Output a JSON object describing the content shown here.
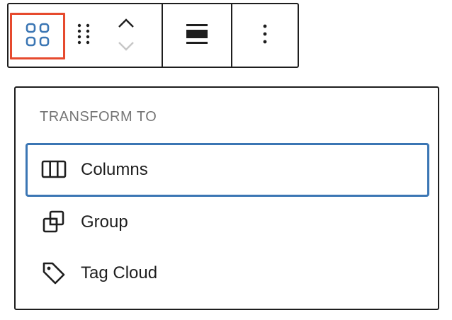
{
  "toolbar": {
    "parent_icon": "block-default-grid-icon",
    "drag_icon": "drag-handle-icon",
    "move_up_icon": "chevron-up-icon",
    "move_down_icon": "chevron-down-icon",
    "align_icon": "align-full-width-icon",
    "more_icon": "more-vertical-icon",
    "highlight_color": "#e64a2e"
  },
  "transform": {
    "heading": "TRANSFORM TO",
    "items": [
      {
        "label": "Columns",
        "icon": "columns-icon",
        "focused": true
      },
      {
        "label": "Group",
        "icon": "group-icon",
        "focused": false
      },
      {
        "label": "Tag Cloud",
        "icon": "tag-icon",
        "focused": false
      }
    ],
    "focus_color": "#3b76b4"
  }
}
